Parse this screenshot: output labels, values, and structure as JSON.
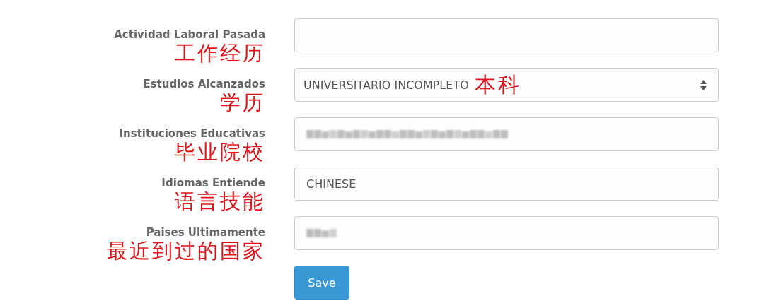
{
  "form": {
    "fields": [
      {
        "kind": "text",
        "label": "Actividad Laboral Pasada",
        "note": "工作经历"
      },
      {
        "kind": "select",
        "label": "Estudios Alcanzados",
        "note": "学历",
        "value": "UNIVERSITARIO INCOMPLETO",
        "value_note": "本科"
      },
      {
        "kind": "text",
        "label": "Instituciones Educativas",
        "note": "毕业院校",
        "blurred": true
      },
      {
        "kind": "text",
        "label": "Idiomas Entiende",
        "note": "语言技能",
        "value": "CHINESE"
      },
      {
        "kind": "text",
        "label": "Paises Ultimamente",
        "note": "最近到过的国家",
        "blurred": true,
        "blur_short": true
      }
    ],
    "save_button": "Save"
  }
}
